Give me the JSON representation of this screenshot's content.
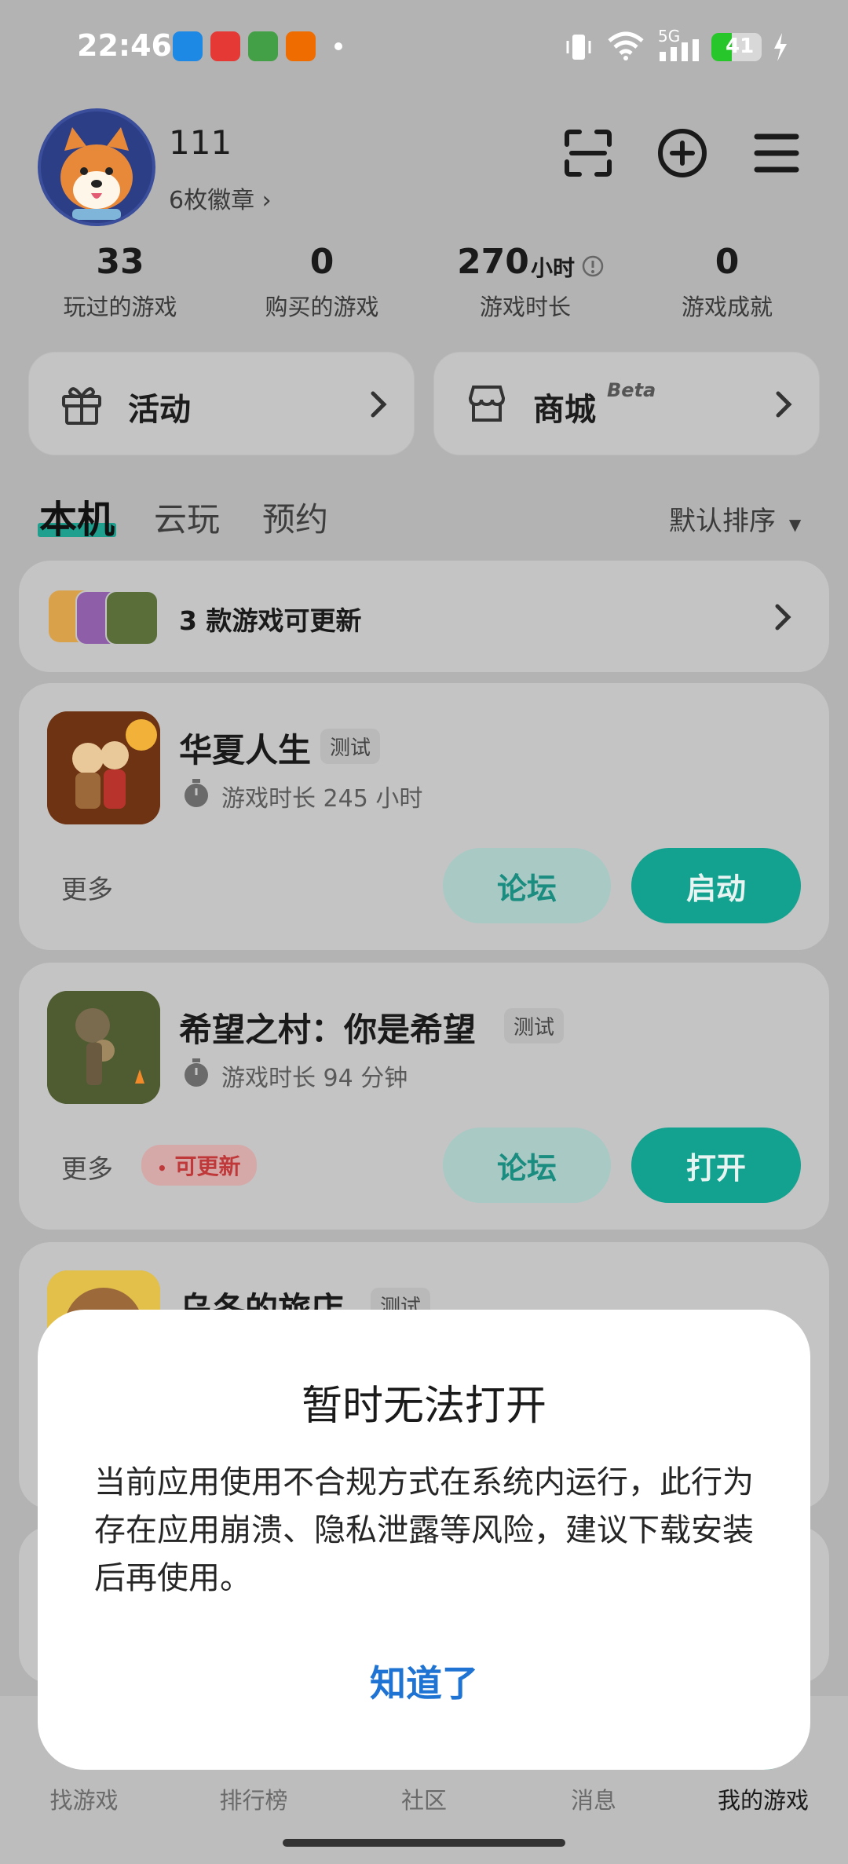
{
  "status_bar": {
    "time": "22:46",
    "network": "5G",
    "battery": "41",
    "battery_level": 0.41,
    "app_icons": [
      {
        "name": "bird-app-icon",
        "color": "#1e88e5"
      },
      {
        "name": "red-app-icon",
        "color": "#e53935"
      },
      {
        "name": "green-app-icon",
        "color": "#43a047"
      },
      {
        "name": "orange-app-icon",
        "color": "#ef6c00"
      }
    ]
  },
  "profile": {
    "username": "111",
    "badges": "6枚徽章 ›"
  },
  "stats": [
    {
      "value": "33",
      "unit": "",
      "label": "玩过的游戏"
    },
    {
      "value": "0",
      "unit": "",
      "label": "购买的游戏"
    },
    {
      "value": "270",
      "unit": "小时",
      "label": "游戏时长"
    },
    {
      "value": "0",
      "unit": "",
      "label": "游戏成就"
    }
  ],
  "quick_links": {
    "activity": "活动",
    "store": "商城",
    "store_tag": "Beta"
  },
  "tabs": {
    "local": "本机",
    "cloud": "云玩",
    "reserve": "预约",
    "sort": "默认排序"
  },
  "update_banner": {
    "text": "3 款游戏可更新"
  },
  "games": [
    {
      "name": "华夏人生",
      "tag": "测试",
      "playtime": "游戏时长 245 小时",
      "more": "更多",
      "update": "",
      "forum_label": "论坛",
      "action_label": "启动"
    },
    {
      "name": "希望之村：你是希望",
      "tag": "测试",
      "playtime": "游戏时长 94 分钟",
      "more": "更多",
      "update": "可更新",
      "forum_label": "论坛",
      "action_label": "打开"
    },
    {
      "name": "乌冬的旅店",
      "tag": "测试"
    }
  ],
  "nav": {
    "find": "找游戏",
    "ranking": "排行榜",
    "community": "社区",
    "messages": "消息",
    "my_games": "我的游戏"
  },
  "dialog": {
    "title": "暂时无法打开",
    "body": "当前应用使用不合规方式在系统内运行，此行为存在应用崩溃、隐私泄露等风险，建议下载安装后再使用。",
    "confirm": "知道了"
  },
  "colors": {
    "accent": "#12a28f",
    "dialog_button": "#1f74d3",
    "update_red": "#c0393a"
  }
}
